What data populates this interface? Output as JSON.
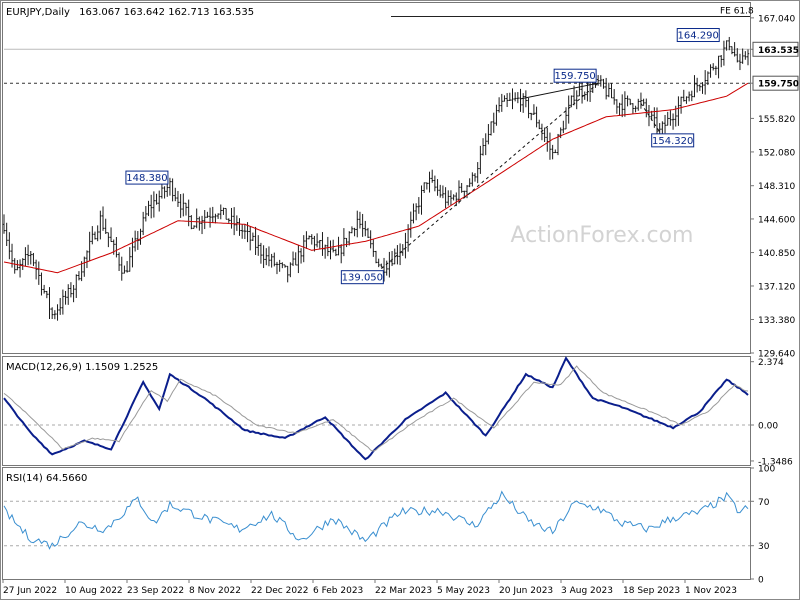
{
  "chart_data": [
    {
      "type": "ohlc",
      "panel": "price",
      "title": "EURJPY,Daily",
      "ohlc_readout": "163.067 163.642 162.713 163.535",
      "watermark": "ActionForex.com",
      "ylim": [
        129.64,
        168.7
      ],
      "y_ticks": [
        "167.040",
        "163.535",
        "159.750",
        "155.820",
        "152.080",
        "148.310",
        "144.600",
        "140.850",
        "137.120",
        "133.380",
        "129.640"
      ],
      "x_ticks": [
        "27 Jun 2022",
        "10 Aug 2022",
        "23 Sep 2022",
        "8 Nov 2022",
        "22 Dec 2022",
        "6 Feb 2023",
        "22 Mar 2023",
        "5 May 2023",
        "20 Jun 2023",
        "3 Aug 2023",
        "18 Sep 2023",
        "1 Nov 2023"
      ],
      "price_anchors": [
        {
          "day": 0,
          "value": 144.0
        },
        {
          "day": 8,
          "value": 138.5
        },
        {
          "day": 20,
          "value": 140.8
        },
        {
          "day": 36,
          "value": 133.9
        },
        {
          "day": 52,
          "value": 137.0
        },
        {
          "day": 72,
          "value": 144.6
        },
        {
          "day": 90,
          "value": 138.5
        },
        {
          "day": 108,
          "value": 145.8
        },
        {
          "day": 124,
          "value": 148.4
        },
        {
          "day": 140,
          "value": 144.2
        },
        {
          "day": 160,
          "value": 145.6
        },
        {
          "day": 180,
          "value": 143.0
        },
        {
          "day": 196,
          "value": 140.3
        },
        {
          "day": 212,
          "value": 138.5
        },
        {
          "day": 228,
          "value": 142.5
        },
        {
          "day": 248,
          "value": 140.3
        },
        {
          "day": 264,
          "value": 144.6
        },
        {
          "day": 282,
          "value": 139.05
        },
        {
          "day": 298,
          "value": 141.5
        },
        {
          "day": 316,
          "value": 149.0
        },
        {
          "day": 332,
          "value": 146.5
        },
        {
          "day": 350,
          "value": 149.0
        },
        {
          "day": 370,
          "value": 157.2
        },
        {
          "day": 386,
          "value": 158.0
        },
        {
          "day": 398,
          "value": 155.6
        },
        {
          "day": 410,
          "value": 151.8
        },
        {
          "day": 426,
          "value": 158.5
        },
        {
          "day": 444,
          "value": 159.75
        },
        {
          "day": 458,
          "value": 157.5
        },
        {
          "day": 476,
          "value": 157.5
        },
        {
          "day": 490,
          "value": 154.32
        },
        {
          "day": 508,
          "value": 158.0
        },
        {
          "day": 526,
          "value": 160.8
        },
        {
          "day": 542,
          "value": 164.29
        },
        {
          "day": 550,
          "value": 161.5
        },
        {
          "day": 556,
          "value": 163.535
        }
      ],
      "ma_anchors": [
        {
          "day": 0,
          "value": 139.8
        },
        {
          "day": 40,
          "value": 138.6
        },
        {
          "day": 80,
          "value": 140.8
        },
        {
          "day": 130,
          "value": 144.4
        },
        {
          "day": 180,
          "value": 144.0
        },
        {
          "day": 230,
          "value": 141.1
        },
        {
          "day": 270,
          "value": 142.1
        },
        {
          "day": 310,
          "value": 143.8
        },
        {
          "day": 360,
          "value": 148.6
        },
        {
          "day": 410,
          "value": 153.5
        },
        {
          "day": 450,
          "value": 156.0
        },
        {
          "day": 500,
          "value": 156.8
        },
        {
          "day": 540,
          "value": 158.3
        },
        {
          "day": 556,
          "value": 159.75
        }
      ],
      "levels": [
        {
          "label": "FE 61.8",
          "value": 167.2,
          "style": "solid"
        },
        {
          "label": "163.535",
          "value": 163.535,
          "style": "thin"
        },
        {
          "label": "159.750",
          "value": 159.75,
          "style": "dashed"
        }
      ],
      "annotations": [
        {
          "label": "164.290",
          "day": 536,
          "value": 164.29
        },
        {
          "label": "159.750",
          "day": 444,
          "value": 159.75
        },
        {
          "label": "154.320",
          "day": 490,
          "value": 154.32
        },
        {
          "label": "148.380",
          "day": 124,
          "value": 148.38
        },
        {
          "label": "139.050",
          "day": 282,
          "value": 139.05
        }
      ],
      "trendlines": [
        {
          "from": {
            "day": 282,
            "value": 139.05
          },
          "to": {
            "day": 444,
            "value": 159.75
          },
          "style": "dashed"
        },
        {
          "from": {
            "day": 386,
            "value": 158.0
          },
          "to": {
            "day": 444,
            "value": 159.75
          },
          "style": "solid"
        },
        {
          "from": {
            "day": 476,
            "value": 157.5
          },
          "to": {
            "day": 490,
            "value": 154.32
          },
          "style": "dashed"
        }
      ],
      "colors": {
        "candles": "#1a1a1a",
        "ma": "#cc0000",
        "levels": "#333333",
        "label_border": "#0a2a8a",
        "label_text": "#0a2a8a"
      }
    },
    {
      "type": "line",
      "panel": "macd",
      "title": "MACD(12,26,9) 1.1509 1.2525",
      "ylim": [
        -1.5,
        2.55
      ],
      "y_ticks": [
        "2.374",
        "0.00",
        "-1.3486"
      ],
      "series": [
        {
          "name": "MACD",
          "color": "#0a1e8c",
          "anchors": [
            {
              "day": 0,
              "value": 1.0
            },
            {
              "day": 20,
              "value": -0.3
            },
            {
              "day": 36,
              "value": -1.1
            },
            {
              "day": 60,
              "value": -0.6
            },
            {
              "day": 80,
              "value": -0.9
            },
            {
              "day": 104,
              "value": 1.6
            },
            {
              "day": 116,
              "value": 0.6
            },
            {
              "day": 124,
              "value": 1.9
            },
            {
              "day": 150,
              "value": 1.0
            },
            {
              "day": 180,
              "value": -0.2
            },
            {
              "day": 210,
              "value": -0.5
            },
            {
              "day": 240,
              "value": 0.3
            },
            {
              "day": 270,
              "value": -1.3
            },
            {
              "day": 300,
              "value": 0.2
            },
            {
              "day": 330,
              "value": 1.2
            },
            {
              "day": 360,
              "value": -0.4
            },
            {
              "day": 390,
              "value": 1.9
            },
            {
              "day": 410,
              "value": 1.4
            },
            {
              "day": 420,
              "value": 2.5
            },
            {
              "day": 440,
              "value": 1.0
            },
            {
              "day": 460,
              "value": 0.7
            },
            {
              "day": 480,
              "value": 0.3
            },
            {
              "day": 500,
              "value": -0.1
            },
            {
              "day": 520,
              "value": 0.5
            },
            {
              "day": 540,
              "value": 1.7
            },
            {
              "day": 556,
              "value": 1.15
            }
          ]
        },
        {
          "name": "Signal",
          "color": "#9a9a9a",
          "anchors": [
            {
              "day": 0,
              "value": 1.2
            },
            {
              "day": 24,
              "value": 0.1
            },
            {
              "day": 44,
              "value": -0.9
            },
            {
              "day": 66,
              "value": -0.5
            },
            {
              "day": 86,
              "value": -0.6
            },
            {
              "day": 110,
              "value": 1.3
            },
            {
              "day": 122,
              "value": 0.9
            },
            {
              "day": 132,
              "value": 1.7
            },
            {
              "day": 158,
              "value": 1.1
            },
            {
              "day": 188,
              "value": 0.0
            },
            {
              "day": 218,
              "value": -0.3
            },
            {
              "day": 246,
              "value": 0.2
            },
            {
              "day": 276,
              "value": -1.0
            },
            {
              "day": 306,
              "value": 0.1
            },
            {
              "day": 336,
              "value": 1.0
            },
            {
              "day": 366,
              "value": -0.1
            },
            {
              "day": 396,
              "value": 1.6
            },
            {
              "day": 416,
              "value": 1.5
            },
            {
              "day": 428,
              "value": 2.2
            },
            {
              "day": 448,
              "value": 1.2
            },
            {
              "day": 468,
              "value": 0.8
            },
            {
              "day": 488,
              "value": 0.4
            },
            {
              "day": 506,
              "value": 0.0
            },
            {
              "day": 526,
              "value": 0.5
            },
            {
              "day": 546,
              "value": 1.5
            },
            {
              "day": 556,
              "value": 1.25
            }
          ]
        }
      ]
    },
    {
      "type": "line",
      "panel": "rsi",
      "title": "RSI(14) 64.5660",
      "ylim": [
        0,
        100
      ],
      "y_ticks": [
        "100",
        "70",
        "30",
        "0"
      ],
      "guide_levels": [
        70,
        30
      ],
      "series": [
        {
          "name": "RSI",
          "color": "#3a8fd0",
          "anchors": [
            {
              "day": 0,
              "value": 62
            },
            {
              "day": 18,
              "value": 38
            },
            {
              "day": 36,
              "value": 30
            },
            {
              "day": 56,
              "value": 50
            },
            {
              "day": 76,
              "value": 45
            },
            {
              "day": 100,
              "value": 72
            },
            {
              "day": 112,
              "value": 50
            },
            {
              "day": 124,
              "value": 67
            },
            {
              "day": 150,
              "value": 55
            },
            {
              "day": 176,
              "value": 45
            },
            {
              "day": 200,
              "value": 58
            },
            {
              "day": 222,
              "value": 35
            },
            {
              "day": 246,
              "value": 55
            },
            {
              "day": 270,
              "value": 34
            },
            {
              "day": 296,
              "value": 60
            },
            {
              "day": 326,
              "value": 62
            },
            {
              "day": 352,
              "value": 48
            },
            {
              "day": 372,
              "value": 76
            },
            {
              "day": 392,
              "value": 52
            },
            {
              "day": 410,
              "value": 42
            },
            {
              "day": 426,
              "value": 68
            },
            {
              "day": 444,
              "value": 64
            },
            {
              "day": 462,
              "value": 50
            },
            {
              "day": 482,
              "value": 45
            },
            {
              "day": 500,
              "value": 55
            },
            {
              "day": 520,
              "value": 60
            },
            {
              "day": 540,
              "value": 74
            },
            {
              "day": 550,
              "value": 60
            },
            {
              "day": 556,
              "value": 64.57
            }
          ]
        }
      ]
    }
  ]
}
